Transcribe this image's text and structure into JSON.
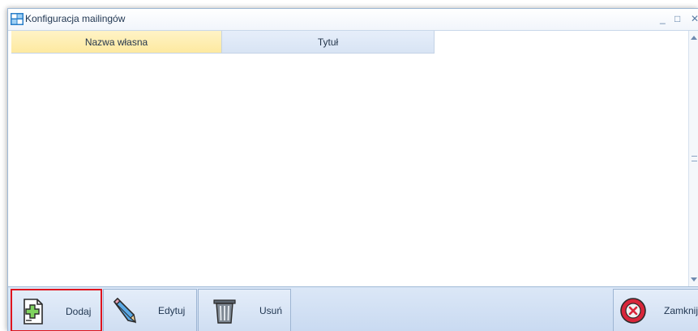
{
  "window": {
    "title": "Konfiguracja mailingów",
    "minimize_glyph": "_",
    "maximize_glyph": "□",
    "close_glyph": "✕"
  },
  "grid": {
    "columns": [
      "Nazwa własna",
      "Tytuł"
    ],
    "rows": []
  },
  "toolbar": {
    "add_label": "Dodaj",
    "edit_label": "Edytuj",
    "delete_label": "Usuń",
    "close_label": "Zamknij"
  },
  "icons": {
    "app": "mail-config-icon",
    "add": "document-add-icon",
    "edit": "pencil-icon",
    "delete": "trash-icon",
    "close": "close-circle-icon"
  },
  "colors": {
    "selected_header": "#fde9a0",
    "header": "#d8e4f4",
    "toolbar": "#c9daf1",
    "highlight_border": "#e0141e",
    "close_icon": "#d9263a"
  }
}
